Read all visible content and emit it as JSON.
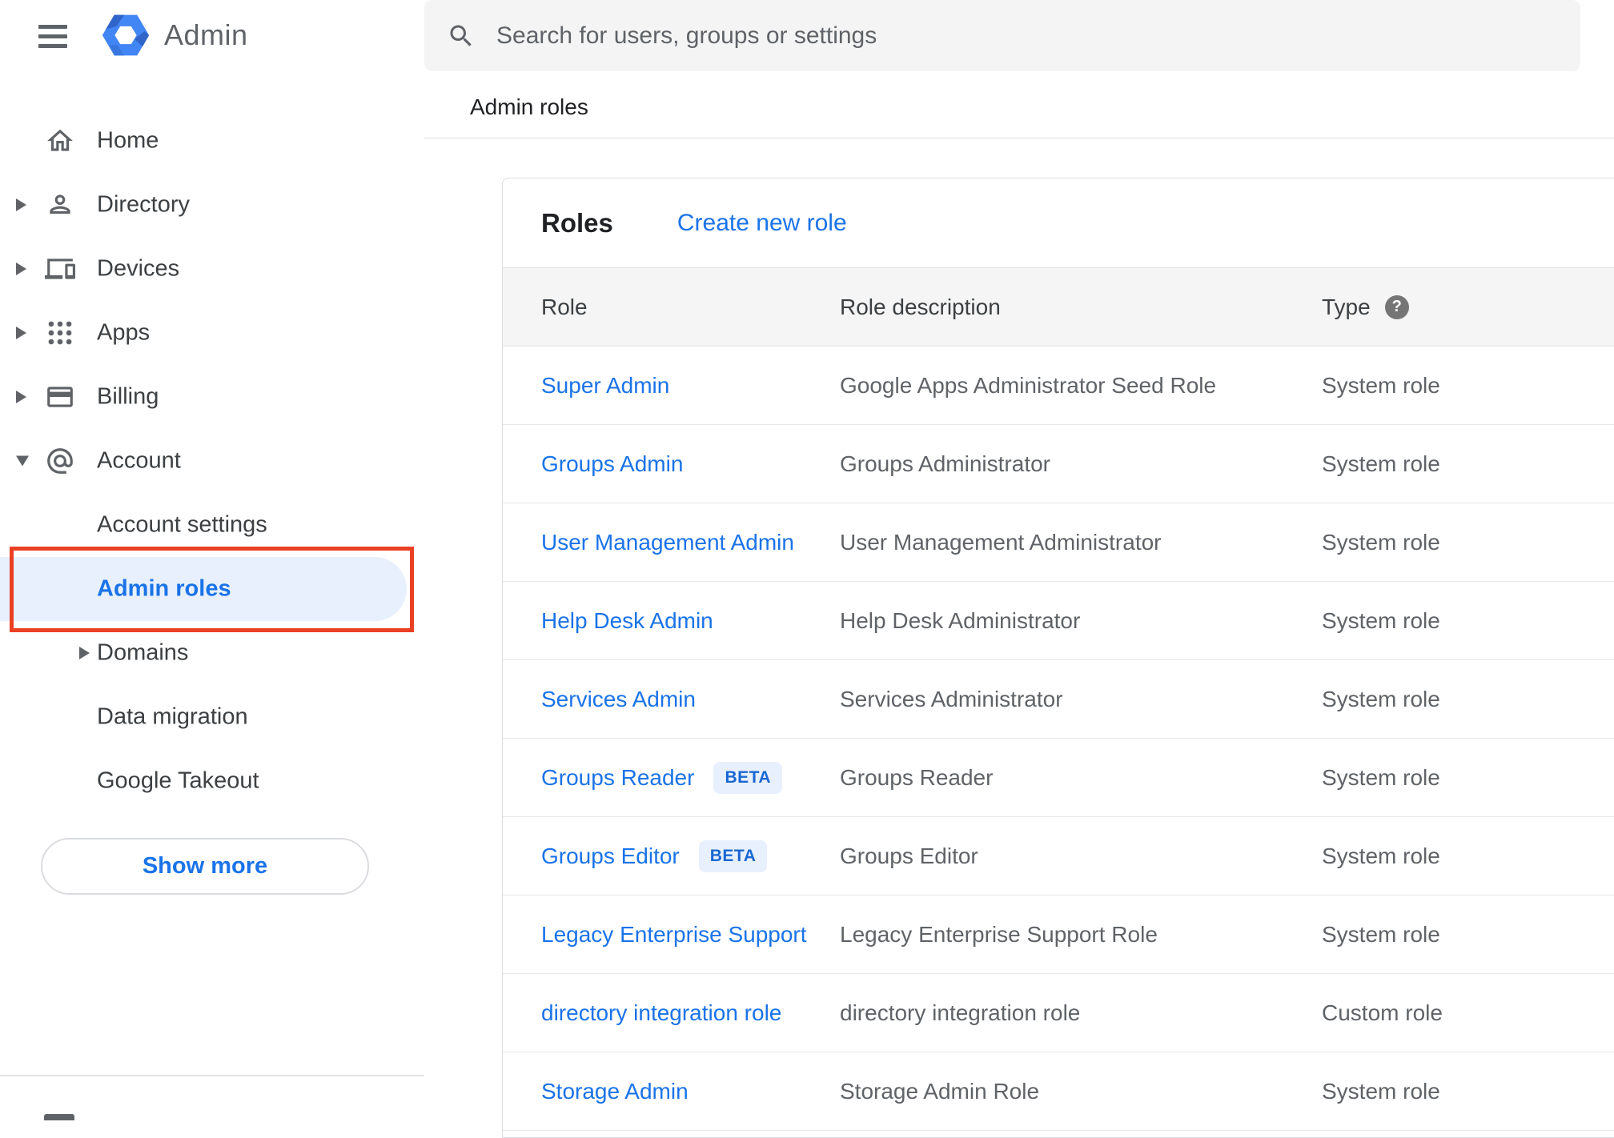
{
  "topbar": {
    "app_name": "Admin",
    "search_placeholder": "Search for users, groups or settings"
  },
  "breadcrumb": "Admin roles",
  "sidebar": {
    "items": [
      {
        "label": "Home"
      },
      {
        "label": "Directory"
      },
      {
        "label": "Devices"
      },
      {
        "label": "Apps"
      },
      {
        "label": "Billing"
      },
      {
        "label": "Account"
      },
      {
        "label": "Account settings"
      },
      {
        "label": "Admin roles",
        "selected": true
      },
      {
        "label": "Domains"
      },
      {
        "label": "Data migration"
      },
      {
        "label": "Google Takeout"
      }
    ],
    "show_more_label": "Show more"
  },
  "main": {
    "title": "Roles",
    "create_link": "Create new role",
    "table": {
      "columns": [
        "Role",
        "Role description",
        "Type"
      ],
      "help_glyph": "?",
      "rows": [
        {
          "role": "Super Admin",
          "description": "Google Apps Administrator Seed Role",
          "type": "System role"
        },
        {
          "role": "Groups Admin",
          "description": "Groups Administrator",
          "type": "System role"
        },
        {
          "role": "User Management Admin",
          "description": "User Management Administrator",
          "type": "System role"
        },
        {
          "role": "Help Desk Admin",
          "description": "Help Desk Administrator",
          "type": "System role"
        },
        {
          "role": "Services Admin",
          "description": "Services Administrator",
          "type": "System role"
        },
        {
          "role": "Groups Reader",
          "beta_label": "BETA",
          "description": "Groups Reader",
          "type": "System role"
        },
        {
          "role": "Groups Editor",
          "beta_label": "BETA",
          "description": "Groups Editor",
          "type": "System role"
        },
        {
          "role": "Legacy Enterprise Support",
          "description": "Legacy Enterprise Support Role",
          "type": "System role"
        },
        {
          "role": "directory integration role",
          "description": "directory integration role",
          "type": "Custom role"
        },
        {
          "role": "Storage Admin",
          "description": "Storage Admin Role",
          "type": "System role"
        }
      ]
    }
  },
  "annotation": {
    "type": "highlight-box",
    "target": "Admin roles"
  },
  "colors": {
    "accent_blue": "#1a73e8",
    "selected_item_bg": "#e8f0fe",
    "annotation_red": "#ea4024",
    "beta_badge_bg": "#e8f0fe",
    "beta_badge_text": "#1967d2",
    "table_header_bg": "#f5f5f5",
    "searchbar_bg": "#f4f4f4"
  }
}
